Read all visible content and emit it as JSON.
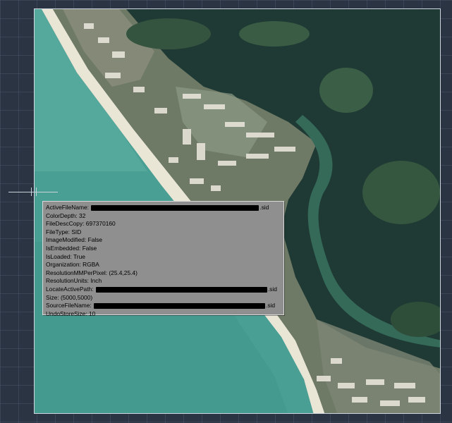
{
  "crosshair_label": "",
  "tooltip": {
    "rows": [
      {
        "key": "ActiveFileName:",
        "value": "",
        "suffix": ".sid"
      },
      {
        "key": "ColorDepth:",
        "value": "32"
      },
      {
        "key": "FileDescCopy:",
        "value": "697370160"
      },
      {
        "key": "FileType:",
        "value": "SID"
      },
      {
        "key": "ImageModified:",
        "value": "False"
      },
      {
        "key": "IsEmbedded:",
        "value": "False"
      },
      {
        "key": "IsLoaded:",
        "value": "True"
      },
      {
        "key": "Organization:",
        "value": "RGBA"
      },
      {
        "key": "ResolutionMMPerPixel:",
        "value": "(25.4,25.4)"
      },
      {
        "key": "ResolutionUnits:",
        "value": "Inch"
      },
      {
        "key": "LocateActivePath:",
        "value": "",
        "suffix": ".sid"
      },
      {
        "key": "Size:",
        "value": "(5000,5000)"
      },
      {
        "key": "SourceFileName:",
        "value": "",
        "suffix": ".sid"
      },
      {
        "key": "UndoStoreSize:",
        "value": "10"
      }
    ]
  },
  "colors": {
    "grid_background": "#2b3442",
    "tooltip_background": "#8f8f8f",
    "ocean": "#4a9f94",
    "bay": "#24423c"
  }
}
